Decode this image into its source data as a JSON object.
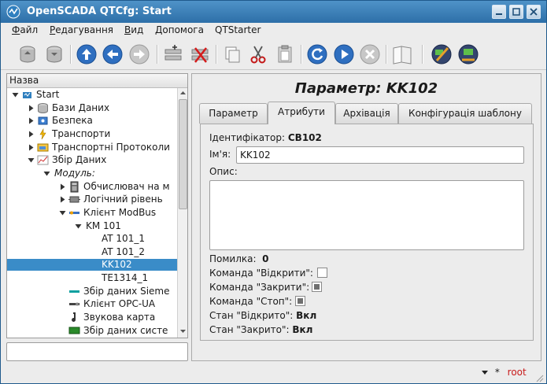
{
  "window": {
    "title": "OpenSCADA QTCfg: Start"
  },
  "menu": [
    {
      "label": "Файл",
      "underline": "Ф",
      "rest": "айл"
    },
    {
      "label": "Редагування",
      "underline": "Р",
      "rest": "едагування"
    },
    {
      "label": "Вид",
      "underline": "В",
      "rest": "ид"
    },
    {
      "label": "Допомога",
      "underline": "Д",
      "rest": "опомога"
    },
    {
      "label": "QTStarter",
      "underline": "",
      "rest": "QTStarter"
    }
  ],
  "toolbar": {
    "icons": [
      "db-load-icon",
      "db-save-icon",
      "up-icon",
      "back-icon",
      "forward-icon",
      "add-item-icon",
      "delete-item-icon",
      "copy-icon",
      "cut-icon",
      "paste-icon",
      "refresh-icon",
      "start-icon",
      "stop-icon",
      "manual-icon",
      "module-icon-1",
      "module-icon-2"
    ]
  },
  "tree": {
    "header": "Назва",
    "items": [
      {
        "label": "Start",
        "level": 0,
        "arrow": "down",
        "icon": "station-icon"
      },
      {
        "label": "Бази Даних",
        "level": 1,
        "arrow": "right",
        "icon": "database-icon"
      },
      {
        "label": "Безпека",
        "level": 1,
        "arrow": "right",
        "icon": "security-icon"
      },
      {
        "label": "Транспорти",
        "level": 1,
        "arrow": "right",
        "icon": "transport-icon"
      },
      {
        "label": "Транспортні Протоколи",
        "level": 1,
        "arrow": "right",
        "icon": "protocol-icon"
      },
      {
        "label": "Збір Даних",
        "level": 1,
        "arrow": "down",
        "icon": "daq-icon"
      },
      {
        "label": "Модуль:",
        "level": 2,
        "arrow": "down",
        "icon": "",
        "italic": true
      },
      {
        "label": "Обчислювач на м",
        "level": 3,
        "arrow": "right",
        "icon": "calculator-icon"
      },
      {
        "label": "Логічний рівень",
        "level": 3,
        "arrow": "right",
        "icon": "logic-icon"
      },
      {
        "label": "Клієнт ModBus",
        "level": 3,
        "arrow": "down",
        "icon": "modbus-icon"
      },
      {
        "label": "KM 101",
        "level": 4,
        "arrow": "down",
        "icon": ""
      },
      {
        "label": "AT 101_1",
        "level": 5,
        "arrow": "",
        "icon": ""
      },
      {
        "label": "AT 101_2",
        "level": 5,
        "arrow": "",
        "icon": ""
      },
      {
        "label": "KK102",
        "level": 5,
        "arrow": "",
        "icon": "",
        "selected": true
      },
      {
        "label": "TE1314_1",
        "level": 5,
        "arrow": "",
        "icon": ""
      },
      {
        "label": "Збір даних Sieme",
        "level": 3,
        "arrow": "",
        "icon": "siemens-icon"
      },
      {
        "label": "Клієнт OPC-UA",
        "level": 3,
        "arrow": "",
        "icon": "opcua-icon"
      },
      {
        "label": "Звукова карта",
        "level": 3,
        "arrow": "",
        "icon": "soundcard-icon"
      },
      {
        "label": "Збір даних систе",
        "level": 3,
        "arrow": "",
        "icon": "system-icon"
      }
    ]
  },
  "page": {
    "title": "Параметр: KK102",
    "tabs": [
      "Параметр",
      "Атрибути",
      "Архівація",
      "Конфігурація шаблону"
    ],
    "active_tab": 1
  },
  "form": {
    "id_label": "Ідентифікатор:",
    "id_value": "CB102",
    "name_label": "Ім'я:",
    "name_value": "KK102",
    "desc_label": "Опис:",
    "error_label": "Помилка:",
    "error_value": "0",
    "cmd_open_label": "Команда \"Відкрити\":",
    "cmd_close_label": "Команда \"Закрити\":",
    "cmd_stop_label": "Команда \"Стоп\":",
    "state_open_label": "Стан \"Відкрито\":",
    "state_open_value": "Вкл",
    "state_closed_label": "Стан \"Закрито\":",
    "state_closed_value": "Вкл"
  },
  "status": {
    "user": "root",
    "star": "*"
  }
}
